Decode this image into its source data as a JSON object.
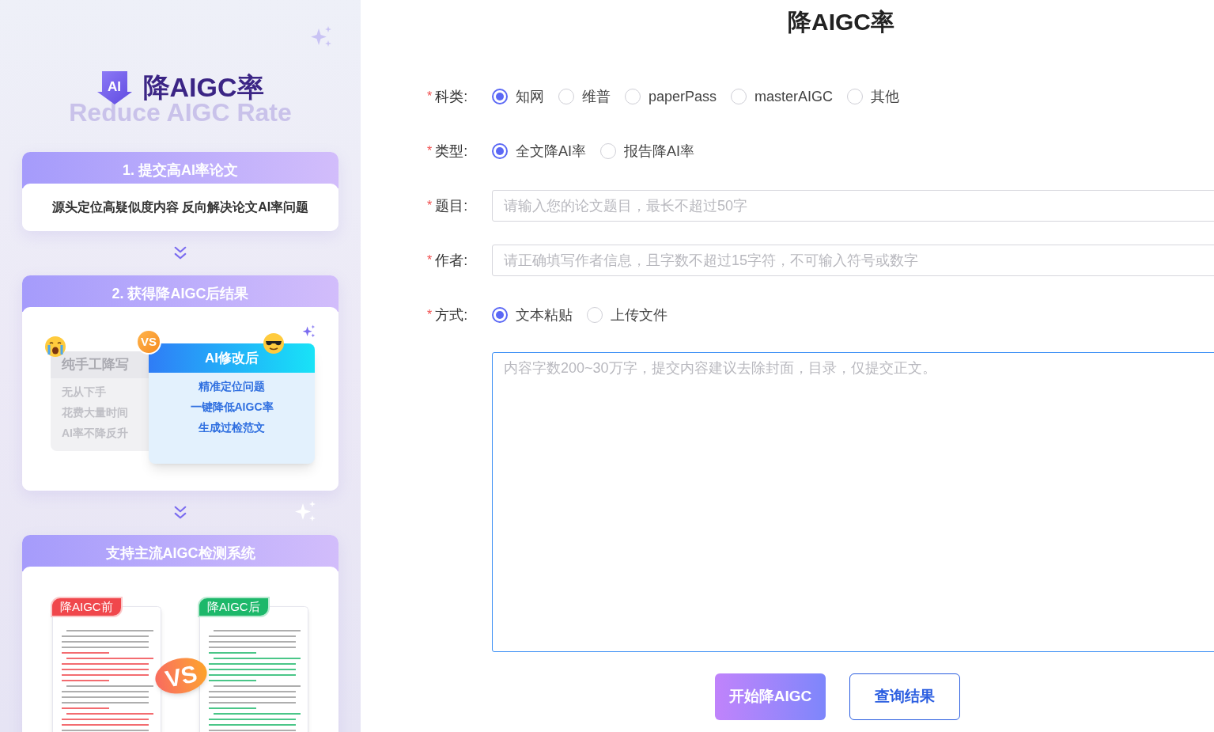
{
  "sidebar": {
    "logo_badge": "AI",
    "title": "降AIGC率",
    "subtitle": "Reduce AIGC Rate",
    "steps": [
      {
        "kind": "text",
        "heading": "1. 提交高AI率论文",
        "body": "源头定位高疑似度内容 反向解决论文AI率问题"
      },
      {
        "kind": "compare",
        "heading": "2. 获得降AIGC后结果",
        "vs": "VS",
        "left": {
          "title": "纯手工降写",
          "points": [
            "无从下手",
            "花费大量时间",
            "AI率不降反升"
          ]
        },
        "right": {
          "title": "AI修改后",
          "points": [
            "精准定位问题",
            "一键降低AIGC率",
            "生成过检范文"
          ]
        }
      },
      {
        "kind": "documents",
        "heading": "支持主流AIGC检测系统",
        "vs": "VS",
        "documents": [
          {
            "tag": "降AIGC前",
            "color": "#f0474c"
          },
          {
            "tag": "降AIGC后",
            "color": "#1db86a"
          }
        ]
      }
    ]
  },
  "form": {
    "title": "降AIGC率",
    "fields": [
      {
        "kind": "radio",
        "label": "科类:",
        "required": "*",
        "options": [
          {
            "label": "知网",
            "selected": true
          },
          {
            "label": "维普",
            "selected": false
          },
          {
            "label": "paperPass",
            "selected": false
          },
          {
            "label": "masterAIGC",
            "selected": false
          },
          {
            "label": "其他",
            "selected": false
          }
        ]
      },
      {
        "kind": "radio",
        "label": "类型:",
        "required": "*",
        "options": [
          {
            "label": "全文降AI率",
            "selected": true
          },
          {
            "label": "报告降AI率",
            "selected": false
          }
        ]
      },
      {
        "kind": "text",
        "label": "题目:",
        "required": "*",
        "placeholder": "请输入您的论文题目，最长不超过50字"
      },
      {
        "kind": "text",
        "label": "作者:",
        "required": "*",
        "placeholder": "请正确填写作者信息，且字数不超过15字符，不可输入符号或数字"
      },
      {
        "kind": "radio",
        "label": "方式:",
        "required": "*",
        "options": [
          {
            "label": "文本粘贴",
            "selected": true
          },
          {
            "label": "上传文件",
            "selected": false
          }
        ]
      }
    ],
    "content": {
      "placeholder": "内容字数200~30万字，提交内容建议去除封面，目录，仅提交正文。"
    },
    "buttons": [
      {
        "kind": "primary",
        "label": "开始降AIGC"
      },
      {
        "kind": "outline",
        "label": "查询结果"
      }
    ]
  }
}
